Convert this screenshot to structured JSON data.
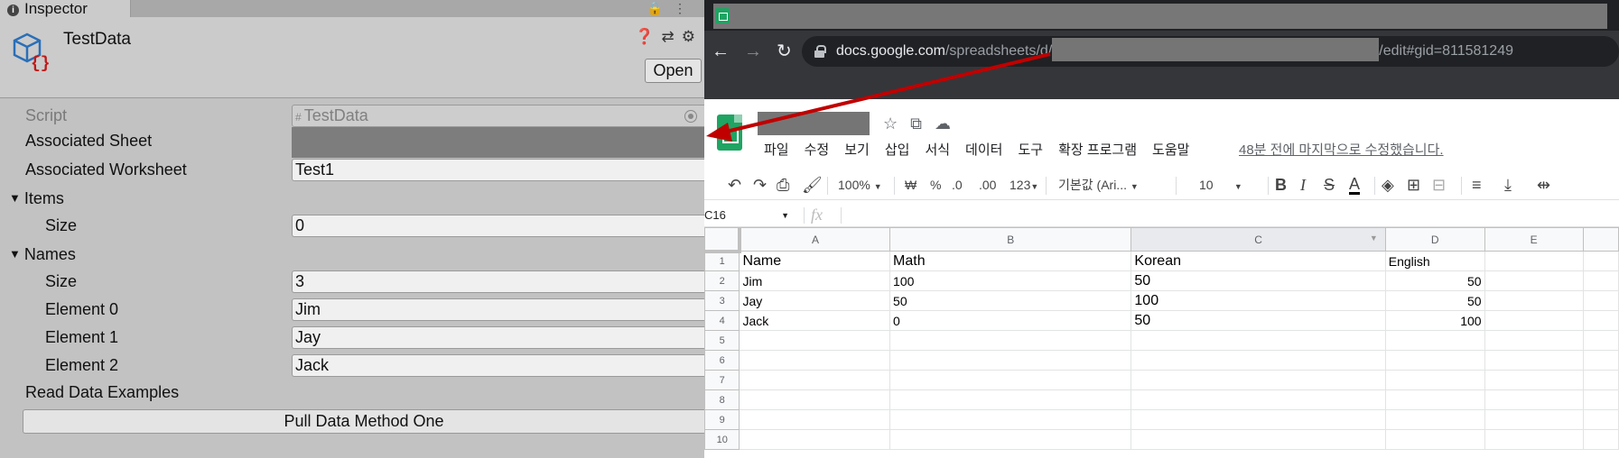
{
  "inspector": {
    "tab_label": "Inspector",
    "asset_title": "TestData",
    "open_label": "Open",
    "script_label": "Script",
    "script_value": "TestData",
    "associated_sheet_label": "Associated Sheet",
    "associated_worksheet_label": "Associated Worksheet",
    "associated_worksheet_value": "Test1",
    "items_label": "Items",
    "items_size_label": "Size",
    "items_size_value": "0",
    "names_label": "Names",
    "names_size_label": "Size",
    "names_size_value": "3",
    "elements": [
      {
        "label": "Element 0",
        "value": "Jim"
      },
      {
        "label": "Element 1",
        "value": "Jay"
      },
      {
        "label": "Element 2",
        "value": "Jack"
      }
    ],
    "read_examples_label": "Read Data Examples",
    "pull_button_label": "Pull Data Method One"
  },
  "browser": {
    "url_host": "docs.google.com",
    "url_path_prefix": "/spreadsheets/d/",
    "url_path_suffix": "/edit#gid=811581249",
    "menu": [
      "파일",
      "수정",
      "보기",
      "삽입",
      "서식",
      "데이터",
      "도구",
      "확장 프로그램",
      "도움말"
    ],
    "last_edit": "48분 전에 마지막으로 수정했습니다.",
    "toolbar": {
      "zoom": "100%",
      "currency": "₩",
      "percent": "%",
      "dec_less": ".0",
      "dec_more": ".00",
      "format_more": "123",
      "font": "기본값 (Ari...",
      "font_size": "10",
      "bold": "B",
      "italic": "I",
      "strike": "S",
      "text_color": "A"
    },
    "namebox": "C16",
    "fx": "fx"
  },
  "sheet": {
    "columns": [
      "A",
      "B",
      "C",
      "D",
      "E"
    ],
    "rows": [
      {
        "n": "1",
        "cells": [
          "Name",
          "Math",
          "Korean",
          "English",
          ""
        ]
      },
      {
        "n": "2",
        "cells": [
          "Jim",
          "100",
          "50",
          "50",
          ""
        ]
      },
      {
        "n": "3",
        "cells": [
          "Jay",
          "50",
          "100",
          "50",
          ""
        ]
      },
      {
        "n": "4",
        "cells": [
          "Jack",
          "0",
          "50",
          "100",
          ""
        ]
      },
      {
        "n": "5",
        "cells": [
          "",
          "",
          "",
          "",
          ""
        ]
      },
      {
        "n": "6",
        "cells": [
          "",
          "",
          "",
          "",
          ""
        ]
      },
      {
        "n": "7",
        "cells": [
          "",
          "",
          "",
          "",
          ""
        ]
      },
      {
        "n": "8",
        "cells": [
          "",
          "",
          "",
          "",
          ""
        ]
      },
      {
        "n": "9",
        "cells": [
          "",
          "",
          "",
          "",
          ""
        ]
      },
      {
        "n": "10",
        "cells": [
          "",
          "",
          "",
          "",
          ""
        ]
      }
    ]
  },
  "colors": {
    "unity_bg": "#c2c2c2",
    "chrome_dark": "#35363a",
    "sheets_green": "#1fa463",
    "annotation_arrow": "#c00000"
  }
}
